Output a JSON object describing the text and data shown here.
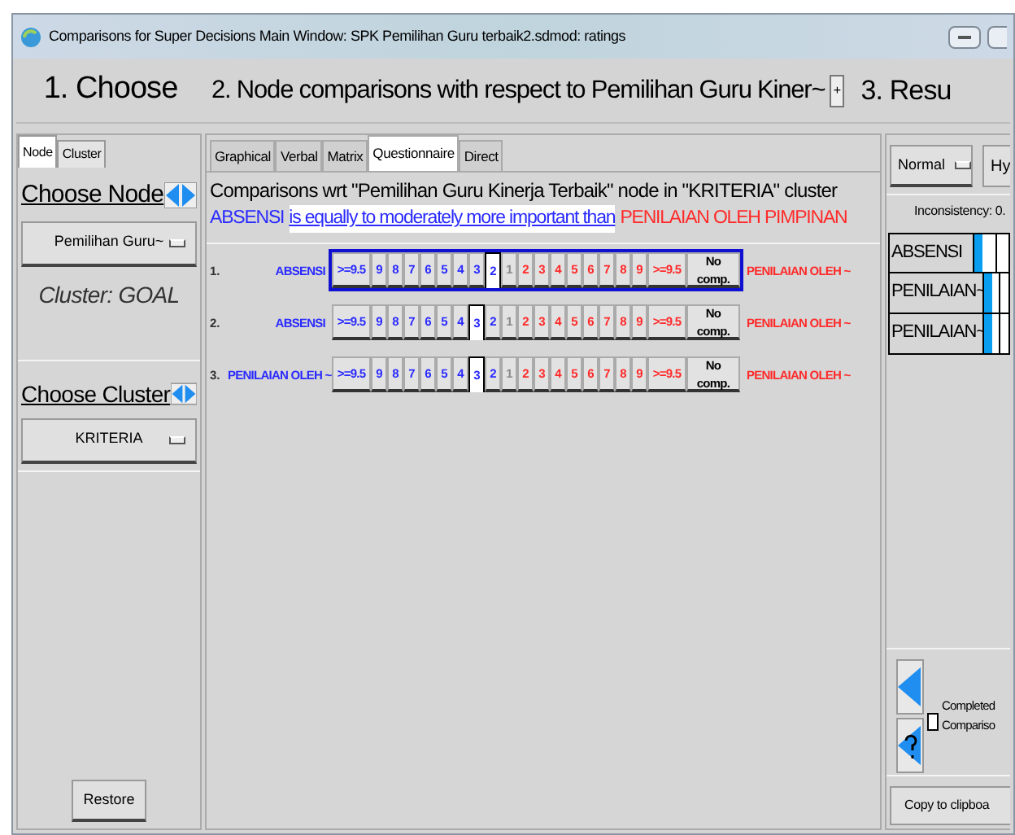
{
  "window": {
    "title": "Comparisons for Super Decisions Main Window: SPK Pemilihan Guru terbaik2.sdmod: ratings"
  },
  "headers": [
    "1. Choose",
    "2. Node comparisons with respect to Pemilihan Guru Kiner~",
    "3. Resu"
  ],
  "header_button": "+",
  "left_panel": {
    "tabs": [
      {
        "label": "Node",
        "selected": true
      },
      {
        "label": "Cluster",
        "selected": false
      }
    ],
    "choose_node": "Choose Node",
    "node_dropdown": "Pemilihan Guru~",
    "cluster_label": "Cluster: GOAL",
    "choose_cluster": "Choose Cluster",
    "cluster_dropdown": "KRITERIA",
    "restore": "Restore"
  },
  "center_panel": {
    "tabs": [
      {
        "label": "Graphical",
        "selected": false
      },
      {
        "label": "Verbal",
        "selected": false
      },
      {
        "label": "Matrix",
        "selected": false
      },
      {
        "label": "Questionnaire",
        "selected": true
      },
      {
        "label": "Direct",
        "selected": false
      }
    ],
    "heading": "Comparisons wrt \"Pemilihan Guru Kinerja Terbaik\" node in \"KRITERIA\" cluster",
    "verdict": {
      "left": "ABSENSI",
      "middle": "is equally to moderately more important than",
      "right": "PENILAIAN OLEH PIMPINAN"
    },
    "rows": [
      {
        "number": "1.",
        "left": "ABSENSI",
        "right": "PENILAIAN OLEH ~",
        "highlighted": true,
        "cells": [
          {
            "label": ">=9.5",
            "kind": "left",
            "selected": false
          },
          {
            "label": "9",
            "kind": "left",
            "selected": false
          },
          {
            "label": "8",
            "kind": "left",
            "selected": false
          },
          {
            "label": "7",
            "kind": "left",
            "selected": false
          },
          {
            "label": "6",
            "kind": "left",
            "selected": false
          },
          {
            "label": "5",
            "kind": "left",
            "selected": false
          },
          {
            "label": "4",
            "kind": "left",
            "selected": false
          },
          {
            "label": "3",
            "kind": "left",
            "selected": false
          },
          {
            "label": "2",
            "kind": "left",
            "selected": true
          },
          {
            "label": "1",
            "kind": "center",
            "selected": false
          },
          {
            "label": "2",
            "kind": "right",
            "selected": false
          },
          {
            "label": "3",
            "kind": "right",
            "selected": false
          },
          {
            "label": "4",
            "kind": "right",
            "selected": false
          },
          {
            "label": "5",
            "kind": "right",
            "selected": false
          },
          {
            "label": "6",
            "kind": "right",
            "selected": false
          },
          {
            "label": "7",
            "kind": "right",
            "selected": false
          },
          {
            "label": "8",
            "kind": "right",
            "selected": false
          },
          {
            "label": "9",
            "kind": "right",
            "selected": false
          },
          {
            "label": ">=9.5",
            "kind": "right",
            "selected": false
          },
          {
            "label": "No comp.",
            "kind": "none",
            "selected": false
          }
        ]
      },
      {
        "number": "2.",
        "left": "ABSENSI",
        "right": "PENILAIAN OLEH ~",
        "highlighted": false,
        "cells": [
          {
            "label": ">=9.5",
            "kind": "left",
            "selected": false
          },
          {
            "label": "9",
            "kind": "left",
            "selected": false
          },
          {
            "label": "8",
            "kind": "left",
            "selected": false
          },
          {
            "label": "7",
            "kind": "left",
            "selected": false
          },
          {
            "label": "6",
            "kind": "left",
            "selected": false
          },
          {
            "label": "5",
            "kind": "left",
            "selected": false
          },
          {
            "label": "4",
            "kind": "left",
            "selected": false
          },
          {
            "label": "3",
            "kind": "left",
            "selected": true
          },
          {
            "label": "2",
            "kind": "left",
            "selected": false
          },
          {
            "label": "1",
            "kind": "center",
            "selected": false
          },
          {
            "label": "2",
            "kind": "right",
            "selected": false
          },
          {
            "label": "3",
            "kind": "right",
            "selected": false
          },
          {
            "label": "4",
            "kind": "right",
            "selected": false
          },
          {
            "label": "5",
            "kind": "right",
            "selected": false
          },
          {
            "label": "6",
            "kind": "right",
            "selected": false
          },
          {
            "label": "7",
            "kind": "right",
            "selected": false
          },
          {
            "label": "8",
            "kind": "right",
            "selected": false
          },
          {
            "label": "9",
            "kind": "right",
            "selected": false
          },
          {
            "label": ">=9.5",
            "kind": "right",
            "selected": false
          },
          {
            "label": "No comp.",
            "kind": "none",
            "selected": false
          }
        ]
      },
      {
        "number": "3.",
        "left": "PENILAIAN OLEH ~",
        "right": "PENILAIAN OLEH ~",
        "highlighted": false,
        "cells": [
          {
            "label": ">=9.5",
            "kind": "left",
            "selected": false
          },
          {
            "label": "9",
            "kind": "left",
            "selected": false
          },
          {
            "label": "8",
            "kind": "left",
            "selected": false
          },
          {
            "label": "7",
            "kind": "left",
            "selected": false
          },
          {
            "label": "6",
            "kind": "left",
            "selected": false
          },
          {
            "label": "5",
            "kind": "left",
            "selected": false
          },
          {
            "label": "4",
            "kind": "left",
            "selected": false
          },
          {
            "label": "3",
            "kind": "left",
            "selected": true
          },
          {
            "label": "2",
            "kind": "left",
            "selected": false
          },
          {
            "label": "1",
            "kind": "center",
            "selected": false
          },
          {
            "label": "2",
            "kind": "right",
            "selected": false
          },
          {
            "label": "3",
            "kind": "right",
            "selected": false
          },
          {
            "label": "4",
            "kind": "right",
            "selected": false
          },
          {
            "label": "5",
            "kind": "right",
            "selected": false
          },
          {
            "label": "6",
            "kind": "right",
            "selected": false
          },
          {
            "label": "7",
            "kind": "right",
            "selected": false
          },
          {
            "label": "8",
            "kind": "right",
            "selected": false
          },
          {
            "label": "9",
            "kind": "right",
            "selected": false
          },
          {
            "label": ">=9.5",
            "kind": "right",
            "selected": false
          },
          {
            "label": "No comp.",
            "kind": "none",
            "selected": false
          }
        ]
      }
    ]
  },
  "right_panel": {
    "mode_dropdown": "Normal",
    "button": "Hy",
    "inconsistency": "Inconsistency: 0.",
    "priorities": [
      {
        "name": "ABSENSI"
      },
      {
        "name": "PENILAIAN~"
      },
      {
        "name": "PENILAIAN~"
      }
    ],
    "completed": {
      "label_1": "Completed",
      "label_2": "Compariso",
      "checked": false
    },
    "copy_button": "Copy to clipboa"
  }
}
